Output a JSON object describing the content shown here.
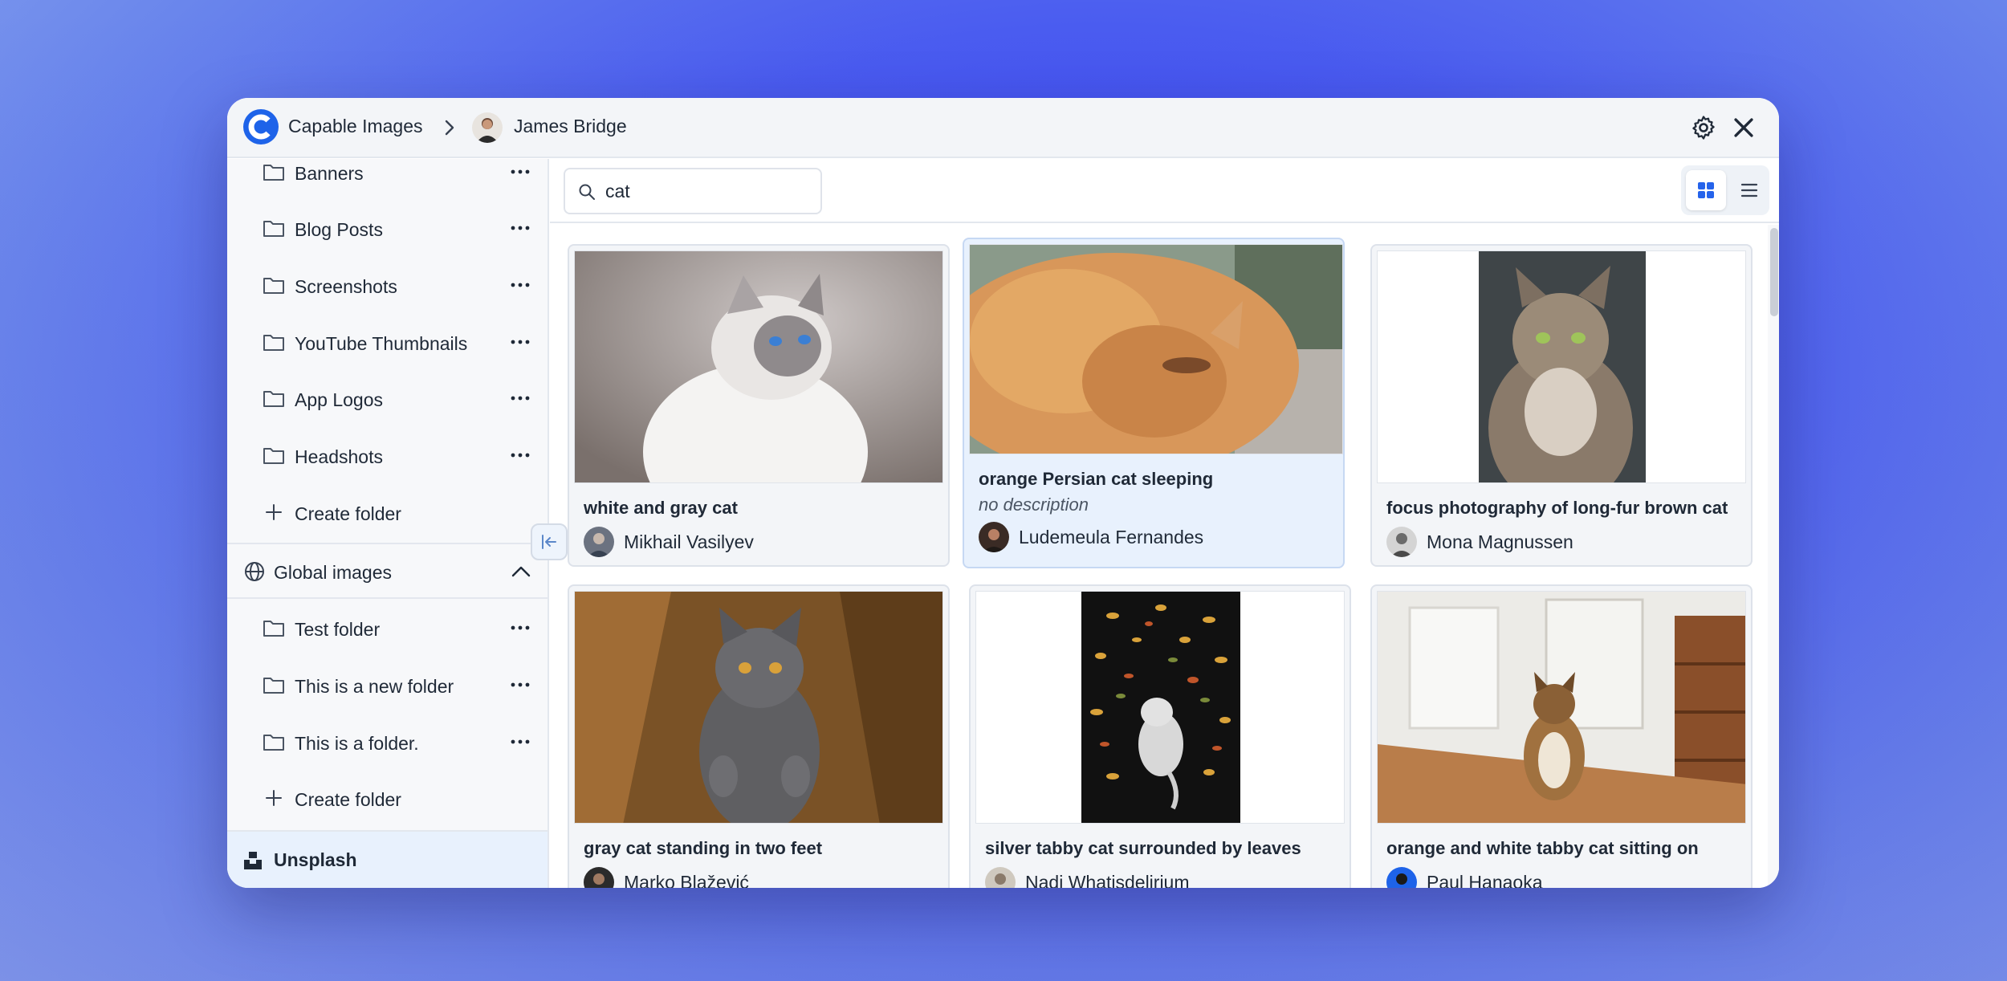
{
  "app": {
    "title": "Capable Images",
    "user": "James Bridge"
  },
  "sidebar": {
    "folders_top": [
      {
        "label": "Banners"
      },
      {
        "label": "Blog Posts"
      },
      {
        "label": "Screenshots"
      },
      {
        "label": "YouTube Thumbnails"
      },
      {
        "label": "App Logos"
      },
      {
        "label": "Headshots"
      }
    ],
    "create_folder_label": "Create folder",
    "global_section": "Global images",
    "folders_global": [
      {
        "label": "Test folder"
      },
      {
        "label": "This is a new folder"
      },
      {
        "label": "This is a folder."
      }
    ],
    "create_folder_label_2": "Create folder",
    "unsplash_label": "Unsplash"
  },
  "search": {
    "value": "cat"
  },
  "view": {
    "mode": "grid"
  },
  "colors": {
    "accent": "#2563eb",
    "selected_bg": "#e8f1fd"
  },
  "results": [
    {
      "title": "white and gray cat",
      "author": "Mikhail Vasilyev",
      "selected": false
    },
    {
      "title": "orange Persian cat sleeping",
      "description": "no description",
      "author": "Ludemeula Fernandes",
      "selected": true
    },
    {
      "title": "focus photography of long-fur brown cat",
      "author": "Mona Magnussen",
      "selected": false
    },
    {
      "title": "gray cat standing in two feet",
      "author": "Marko Blažević",
      "selected": false
    },
    {
      "title": "silver tabby cat surrounded by leaves",
      "author": "Nadi Whatisdelirium",
      "selected": false
    },
    {
      "title": "orange and white tabby cat sitting on",
      "author": "Paul Hanaoka",
      "selected": false
    }
  ]
}
